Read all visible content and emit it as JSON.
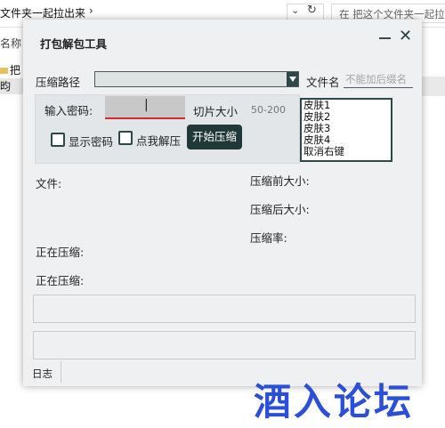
{
  "explorer": {
    "breadcrumb": "文件夹一起拉出来",
    "breadcrumb_chevron": "›",
    "search_placeholder": "在 把这个文件夹一起拉",
    "refresh_symbol": "↻",
    "dropdown_symbol": "⌄",
    "left_column_label": "名称",
    "left_row1": "把",
    "left_row2": "昀"
  },
  "dialog": {
    "title": "打包解包工具",
    "minimize_symbol": "—",
    "close_symbol": "✕",
    "compress_path_label": "压缩路径",
    "compress_path_value": "",
    "filename_label": "文件名",
    "filename_placeholder": "不能加后缀名",
    "password_label": "输入密码:",
    "password_value": "|",
    "slice_size_label": "切片大小",
    "slice_size_placeholder": "50-200",
    "show_password_label": "显示密码",
    "show_password_checked": false,
    "click_unpack_label": "点我解压",
    "click_unpack_checked": false,
    "start_button": "开始压缩",
    "skin_list": [
      "皮肤1",
      "皮肤2",
      "皮肤3",
      "皮肤4",
      "取消右键"
    ],
    "file_label": "文件:",
    "compressing_label_1": "正在压缩:",
    "compressing_label_2": "正在压缩:",
    "size_before_label": "压缩前大小:",
    "size_after_label": "压缩后大小:",
    "ratio_label": "压缩率:",
    "log_label": "日志"
  },
  "watermark": "酒入论坛",
  "colors": {
    "accent_dark": "#203838",
    "password_underline": "#d02a2a",
    "watermark": "#2b4fd6",
    "dialog_bg": "#eef0f2"
  }
}
